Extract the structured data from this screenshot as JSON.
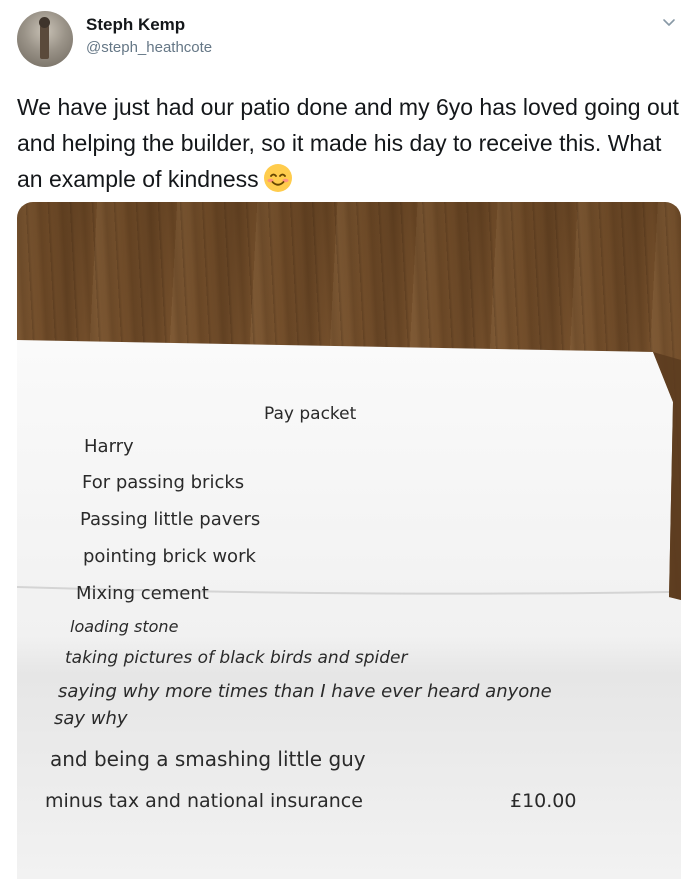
{
  "user": {
    "name": "Steph Kemp",
    "handle": "@steph_heathcote"
  },
  "tweet": {
    "text": "We have just had our patio done and my 6yo has loved going out and helping the builder, so it made his day to receive this. What an example of kindness",
    "emoji": "smiling-face-with-smiling-eyes"
  },
  "icons": {
    "chevron": "chevron-down-icon"
  },
  "pay_packet": {
    "title": "Pay packet",
    "recipient": "Harry",
    "lines": [
      "For passing bricks",
      "Passing little pavers",
      "pointing brick work",
      "Mixing cement",
      "loading stone",
      "taking pictures of black birds and spider",
      "saying why more times than I have ever heard anyone",
      "say why",
      "and being a smashing little guy",
      "minus tax and national insurance"
    ],
    "amount": "£10.00"
  },
  "colors": {
    "text": "#14171a",
    "secondary": "#657786",
    "table_wood": "#7c5530",
    "paper": "#f4f4f4"
  }
}
